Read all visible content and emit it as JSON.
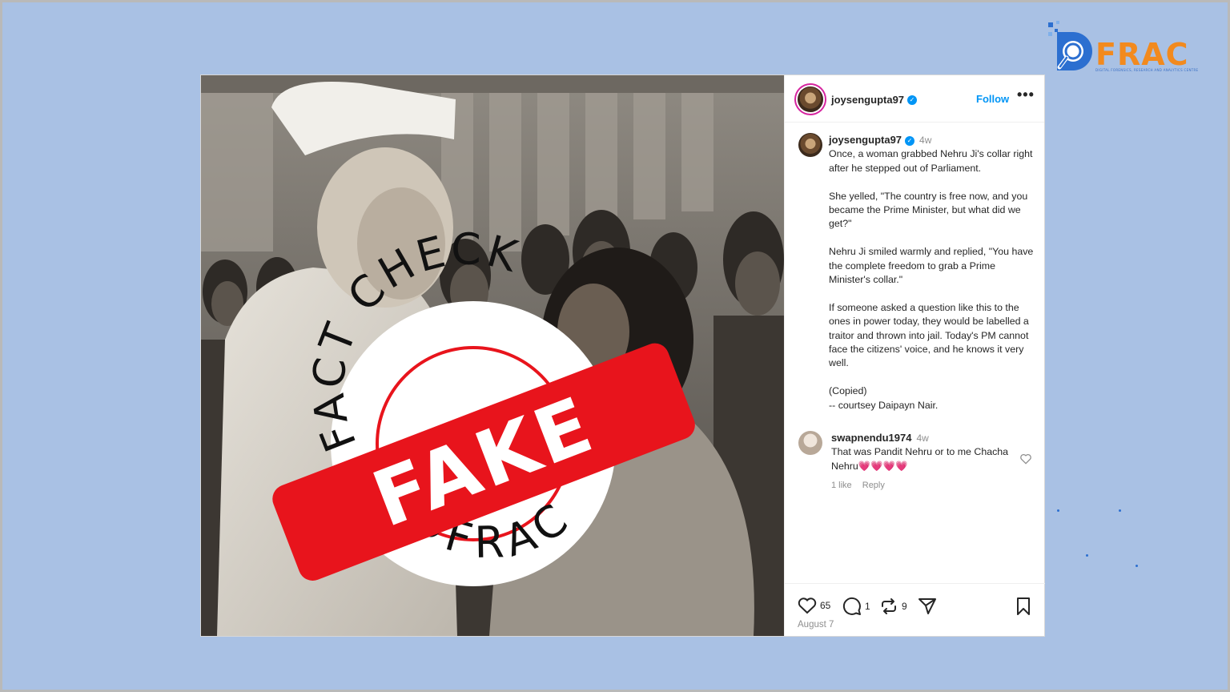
{
  "logo": {
    "text": "FRAC",
    "subtitle": "DIGITAL FORENSICS, RESEARCH AND ANALYTICS CENTRE"
  },
  "post": {
    "username": "joysengupta97",
    "follow_label": "Follow",
    "more_label": "•••",
    "caption_time": "4w",
    "caption_paragraphs": [
      "Once, a woman grabbed Nehru Ji's collar right after he stepped out of Parliament.",
      "She yelled, \"The country is free now, and you became the Prime Minister, but what did we get?\"",
      "Nehru Ji smiled warmly and replied, \"You have the complete freedom to grab a Prime Minister's collar.\"",
      "If someone asked a question like this to the ones in power today, they would be labelled a traitor and thrown into jail. Today's PM cannot face the citizens' voice, and he knows it very well.",
      "(Copied)\n-- courtsey Daipayn Nair."
    ],
    "comment": {
      "username": "swapnendu1974",
      "time": "4w",
      "text": "That was Pandit Nehru or to me Chacha Nehru",
      "emoji": "💗💗💗💗",
      "likes": "1 like",
      "reply_label": "Reply"
    },
    "likes_count": "65",
    "comments_count": "1",
    "reposts_count": "9",
    "date": "August 7"
  },
  "stamp": {
    "top_text": "FACT CHECK",
    "bottom_text": "DFRAC",
    "banner_text": "FAKE",
    "banner_color": "#e8141c"
  },
  "colors": {
    "background": "#a9c1e4",
    "brand_orange": "#f28a1e",
    "brand_blue": "#2c6fd0",
    "link_blue": "#0095f6"
  }
}
